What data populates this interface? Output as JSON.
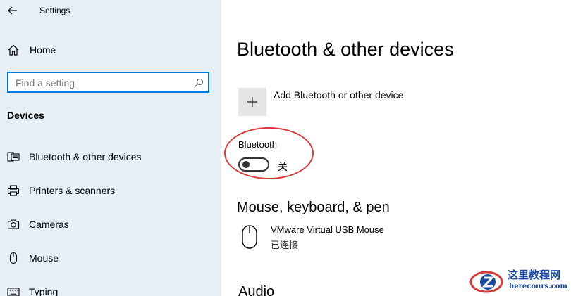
{
  "app": {
    "title": "Settings"
  },
  "sidebar": {
    "home_label": "Home",
    "search_placeholder": "Find a setting",
    "section_title": "Devices",
    "items": [
      {
        "label": "Bluetooth & other devices",
        "icon": "bluetooth-devices-icon"
      },
      {
        "label": "Printers & scanners",
        "icon": "printer-icon"
      },
      {
        "label": "Cameras",
        "icon": "camera-icon"
      },
      {
        "label": "Mouse",
        "icon": "mouse-icon"
      },
      {
        "label": "Typing",
        "icon": "keyboard-icon"
      }
    ]
  },
  "main": {
    "title": "Bluetooth & other devices",
    "add_device_label": "Add Bluetooth or other device",
    "bluetooth": {
      "label": "Bluetooth",
      "state": "关",
      "on": false
    },
    "section_mouse": {
      "title": "Mouse, keyboard, & pen",
      "devices": [
        {
          "name": "VMware Virtual USB Mouse",
          "status": "已连接",
          "icon": "mouse-icon"
        }
      ]
    },
    "section_audio": {
      "title": "Audio"
    }
  },
  "colors": {
    "sidebar_bg": "#e6eef6",
    "accent": "#0078d7",
    "highlight": "#d83b3b",
    "watermark": "#1a4aa3"
  },
  "watermark": {
    "title": "这里教程网",
    "url": "herecours.com"
  }
}
